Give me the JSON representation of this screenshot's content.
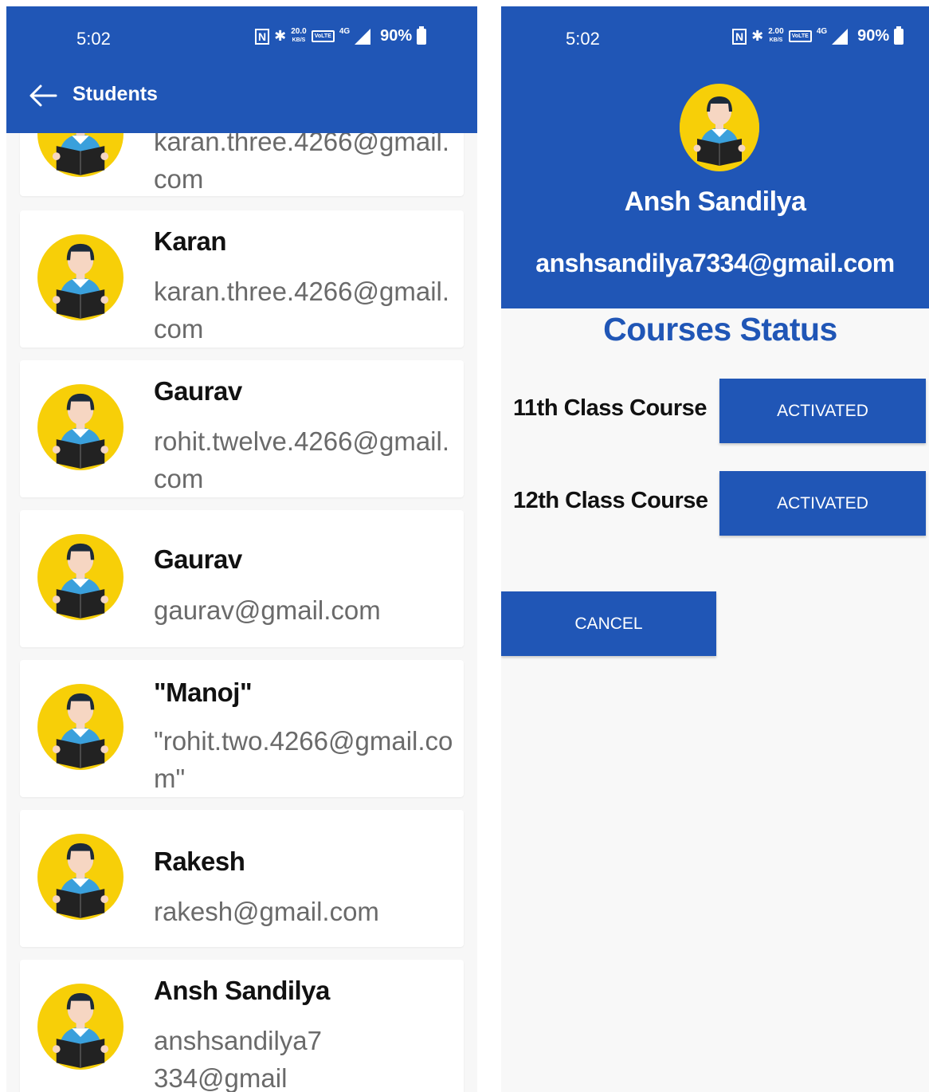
{
  "status_bar": {
    "time": "5:02",
    "nfc_glyph": "N",
    "bluetooth_glyph": "✱",
    "speed_left": {
      "value": "20.0",
      "unit": "KB/S"
    },
    "speed_right": {
      "value": "2.00",
      "unit": "KB/S"
    },
    "volte": "VoLTE",
    "network": "4G",
    "battery": "90%"
  },
  "students_screen": {
    "title": "Students",
    "students": [
      {
        "name": "",
        "email": "karan.three.4266@gmail.com"
      },
      {
        "name": "Karan",
        "email": "karan.three.4266@gmail.com"
      },
      {
        "name": "Gaurav",
        "email": "rohit.twelve.4266@gmail.com"
      },
      {
        "name": "Gaurav",
        "email": "gaurav@gmail.com"
      },
      {
        "name": "\"Manoj\"",
        "email": "\"rohit.two.4266@gmail.com\""
      },
      {
        "name": "Rakesh",
        "email": "rakesh@gmail.com"
      },
      {
        "name": "Ansh Sandilya",
        "email": "anshsandilya7334@gmail"
      }
    ]
  },
  "detail_screen": {
    "name": "Ansh Sandilya",
    "email": "anshsandilya7334@gmail.com",
    "courses_title": "Courses Status",
    "courses": [
      {
        "label": "11th Class Course",
        "status": "ACTIVATED"
      },
      {
        "label": "12th Class Course",
        "status": "ACTIVATED"
      }
    ],
    "cancel_label": "CANCEL"
  },
  "colors": {
    "primary": "#2056b6",
    "avatar_bg": "#f7cf08",
    "background": "#f7f7f7"
  },
  "icons": [
    "back-arrow-icon",
    "nfc-icon",
    "bluetooth-icon",
    "signal-icon",
    "battery-icon",
    "student-avatar-icon"
  ]
}
